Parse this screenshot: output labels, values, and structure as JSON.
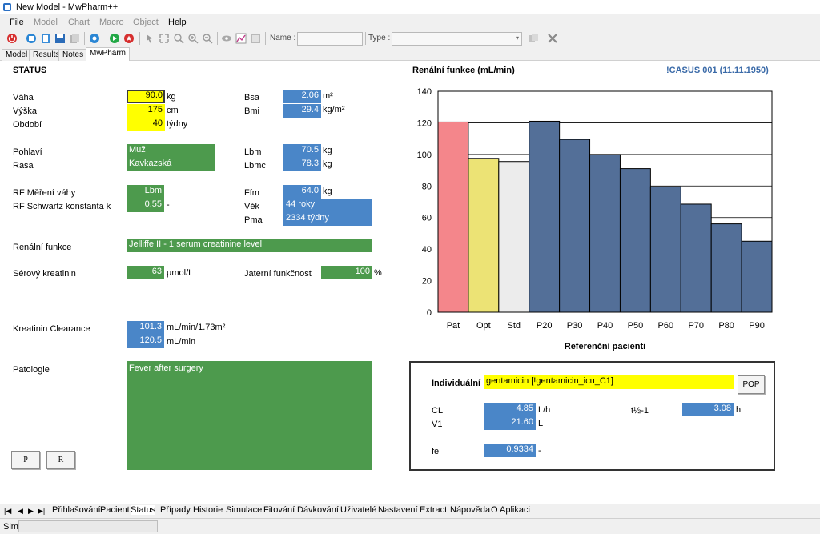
{
  "window": {
    "title": "New Model - MwPharm++"
  },
  "menu": [
    {
      "label": "File",
      "enabled": true
    },
    {
      "label": "Model",
      "enabled": false
    },
    {
      "label": "Chart",
      "enabled": false
    },
    {
      "label": "Macro",
      "enabled": false
    },
    {
      "label": "Object",
      "enabled": false
    },
    {
      "label": "Help",
      "enabled": true
    }
  ],
  "toolbar": {
    "name_label": "Name :",
    "type_label": "Type :"
  },
  "top_tabs": [
    "Model",
    "Results",
    "Notes",
    "MwPharm"
  ],
  "status": {
    "header": "STATUS",
    "vaha": {
      "label": "Váha",
      "value": "90.0",
      "unit": "kg"
    },
    "vyska": {
      "label": "Výška",
      "value": "175",
      "unit": "cm"
    },
    "obdobi": {
      "label": "Období",
      "value": "40",
      "unit": "týdny"
    },
    "bsa": {
      "label": "Bsa",
      "value": "2.06",
      "unit": "m²"
    },
    "bmi": {
      "label": "Bmi",
      "value": "29.4",
      "unit": "kg/m²"
    },
    "pohlavi": {
      "label": "Pohlaví",
      "value": "Muž"
    },
    "rasa": {
      "label": "Rasa",
      "value": "Kavkazská"
    },
    "lbm": {
      "label": "Lbm",
      "value": "70.5",
      "unit": "kg"
    },
    "lbmc": {
      "label": "Lbmc",
      "value": "78.3",
      "unit": "kg"
    },
    "rf_vahy": {
      "label": "RF Měření váhy",
      "value": "Lbm"
    },
    "rf_schwartz": {
      "label": "RF Schwartz konstanta k",
      "value": "0.55",
      "unit": "-"
    },
    "ffm": {
      "label": "Ffm",
      "value": "64.0",
      "unit": "kg"
    },
    "vek": {
      "label": "Věk",
      "value": "44 roky"
    },
    "pma": {
      "label": "Pma",
      "value": "2334 týdny"
    },
    "renalni": {
      "label": "Renální funkce",
      "value": "Jelliffe II - 1 serum creatinine level"
    },
    "kreatinin": {
      "label": "Sérový kreatinin",
      "value": "63",
      "unit": "μmol/L"
    },
    "jaterni": {
      "label": "Jaterní funkčnost",
      "value": "100",
      "unit": "%"
    },
    "clearance": {
      "label": "Kreatinin Clearance",
      "value1": "101.3",
      "unit1": "mL/min/1.73m²",
      "value2": "120.5",
      "unit2": "mL/min"
    },
    "patologie": {
      "label": "Patologie",
      "value": "Fever after surgery"
    },
    "btn_p": "P",
    "btn_r": "R"
  },
  "chart_header": {
    "title": "Renální funkce (mL/min)",
    "casus": "!CASUS 001 (11.11.1950)"
  },
  "chart_data": {
    "type": "bar",
    "title": "Renální funkce (mL/min)",
    "xlabel": "Referenční pacienti",
    "ylabel": "",
    "categories": [
      "Pat",
      "Opt",
      "Std",
      "P20",
      "P30",
      "P40",
      "P50",
      "P60",
      "P70",
      "P80",
      "P90"
    ],
    "values": [
      120.5,
      97.5,
      95.5,
      121,
      109.5,
      100,
      91,
      79.5,
      68.5,
      56,
      45
    ],
    "colors": [
      "#f4868b",
      "#ece375",
      "#ececec",
      "#536f98",
      "#536f98",
      "#536f98",
      "#536f98",
      "#536f98",
      "#536f98",
      "#536f98",
      "#536f98"
    ],
    "ylim": [
      0,
      140
    ],
    "yticks": [
      0,
      20,
      40,
      60,
      80,
      100,
      120,
      140
    ],
    "grid": true
  },
  "pk": {
    "individual_label": "Individuální",
    "drug": "gentamicin [!gentamicin_icu_C1]",
    "pop_button": "POP",
    "cl": {
      "label": "CL",
      "value": "4.85",
      "unit": "L/h"
    },
    "v1": {
      "label": "V1",
      "value": "21.60",
      "unit": "L"
    },
    "thalf": {
      "label": "t½-1",
      "value": "3.08",
      "unit": "h"
    },
    "fe": {
      "label": "fe",
      "value": "0.9334",
      "unit": "-"
    }
  },
  "bottom_tabs": [
    "Přihlašování",
    "Pacient",
    "Status",
    "Případy",
    "Historie",
    "Simulace",
    "Fitování",
    "Dávkování",
    "Uživatelé",
    "Nastavení",
    "Extract",
    "Nápověda",
    "O Aplikaci"
  ],
  "statusbar": {
    "label": "Sim"
  },
  "colors": {
    "yellow": "#ffff00",
    "green": "#4d9a4d",
    "blue": "#4a86c8"
  }
}
